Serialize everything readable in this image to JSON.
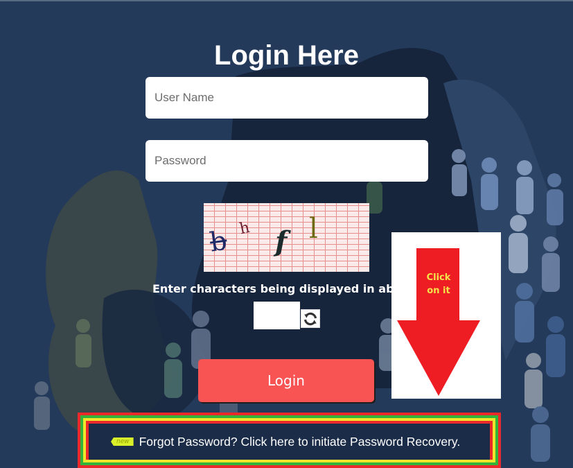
{
  "form": {
    "title": "Login Here",
    "username_placeholder": "User Name",
    "password_placeholder": "Password",
    "captcha_chars": [
      "b",
      "h",
      "f",
      "l"
    ],
    "captcha_instruction": "Enter characters being displayed in above image",
    "captcha_value": "",
    "refresh_icon": "refresh-icon",
    "login_label": "Login"
  },
  "promo": {
    "text_line1": "Click",
    "text_line2": "on it",
    "icon": "down-arrow-icon"
  },
  "footer": {
    "new_badge": "new",
    "forgot_link": "Forgot Password? Click here to initiate Password Recovery."
  },
  "colors": {
    "background": "#243a5a",
    "login_button": "#f95454",
    "arrow": "#ee1d24",
    "arrow_text": "#f5e34a"
  }
}
